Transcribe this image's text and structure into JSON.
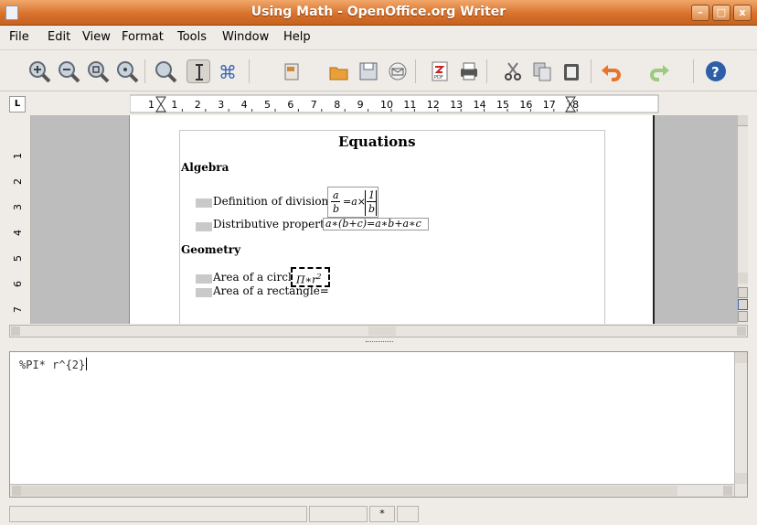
{
  "window": {
    "title": "Using Math - OpenOffice.org Writer",
    "controls": {
      "minimize": "–",
      "maximize": "□",
      "close": "x"
    }
  },
  "menu": [
    "File",
    "Edit",
    "View",
    "Format",
    "Tools",
    "Window",
    "Help"
  ],
  "toolbar": {
    "items": [
      "zoom-in-icon",
      "zoom-out-icon",
      "zoom-page-icon",
      "zoom-fit-icon",
      "zoom-selection-icon",
      "text-cursor-icon",
      "command-icon",
      "insert-icon",
      "open-icon",
      "save-icon",
      "email-icon",
      "pdf-icon",
      "print-icon",
      "cut-icon",
      "copy-icon",
      "paste-icon",
      "undo-icon",
      "redo-icon",
      "help-icon"
    ],
    "pdf_label": "PDF"
  },
  "ruler": {
    "corner": "L",
    "marks": [
      "1",
      "1",
      "2",
      "3",
      "4",
      "5",
      "6",
      "7",
      "8",
      "9",
      "10",
      "11",
      "12",
      "13",
      "14",
      "15",
      "16",
      "17",
      "18"
    ]
  },
  "vruler": [
    "1",
    "2",
    "3",
    "4",
    "5",
    "6",
    "7"
  ],
  "document": {
    "heading": "Equations",
    "sections": [
      {
        "title": "Algebra",
        "items": [
          {
            "label": "Definition of division=",
            "formula": "a/b = a×(1/b)"
          },
          {
            "label": "Distributive property=",
            "formula": "a∗(b+c)=a∗b+a∗c"
          }
        ]
      },
      {
        "title": "Geometry",
        "items": [
          {
            "label": "Area of a circle=",
            "formula": "Π∗r²"
          },
          {
            "label": "Area of a rectangle=",
            "formula": ""
          }
        ]
      }
    ],
    "formula_parts": {
      "a": "a",
      "b": "b",
      "one": "1",
      "eq_times": "=a×",
      "distrib": "a∗(b+c)=a∗b+a∗c",
      "circle": "Π∗r",
      "sup2": "2"
    }
  },
  "editor": {
    "command": "%PI* r^{2}"
  },
  "statusbar": {
    "field3": "*"
  }
}
